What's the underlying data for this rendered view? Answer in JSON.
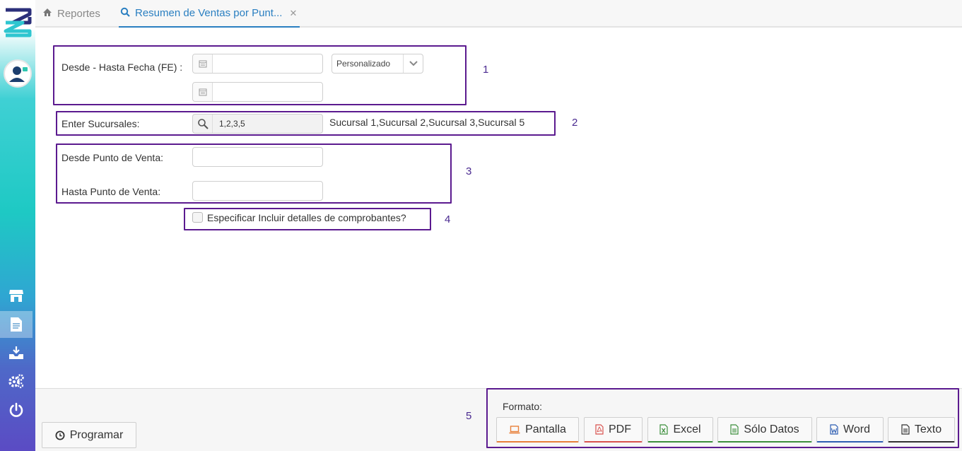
{
  "tabs": [
    {
      "label": "Reportes",
      "icon": "home-icon"
    },
    {
      "label": "Resumen de Ventas por Punt...",
      "icon": "search-icon",
      "active": true
    }
  ],
  "form": {
    "fecha_label": "Desde - Hasta Fecha (FE) :",
    "fecha_desde_value": "",
    "fecha_hasta_value": "",
    "period_select": "Personalizado",
    "sucursales_label": "Enter Sucursales:",
    "sucursales_value": "1,2,3,5",
    "sucursales_desc": "Sucursal 1,Sucursal 2,Sucursal 3,Sucursal 5",
    "desde_punto_label": "Desde Punto de Venta:",
    "desde_punto_value": "",
    "hasta_punto_label": "Hasta Punto de Venta:",
    "hasta_punto_value": "",
    "detalles_label": "Especificar Incluir detalles de comprobantes?"
  },
  "annotations": [
    "1",
    "2",
    "3",
    "4",
    "5"
  ],
  "bottom": {
    "programar_label": "Programar",
    "formato_label": "Formato:",
    "formats": [
      {
        "label": "Pantalla",
        "icon": "laptop-icon",
        "color": "#e8803a"
      },
      {
        "label": "PDF",
        "icon": "pdf-file-icon",
        "color": "#d9534f"
      },
      {
        "label": "Excel",
        "icon": "excel-file-icon",
        "color": "#3c8f3c"
      },
      {
        "label": "Sólo Datos",
        "icon": "data-file-icon",
        "color": "#3c8f3c"
      },
      {
        "label": "Word",
        "icon": "word-file-icon",
        "color": "#2f5fb3"
      },
      {
        "label": "Texto",
        "icon": "text-file-icon",
        "color": "#333333"
      }
    ]
  },
  "colors": {
    "accent": "#2a7fc1",
    "annotation_box": "#5b1a8f"
  }
}
